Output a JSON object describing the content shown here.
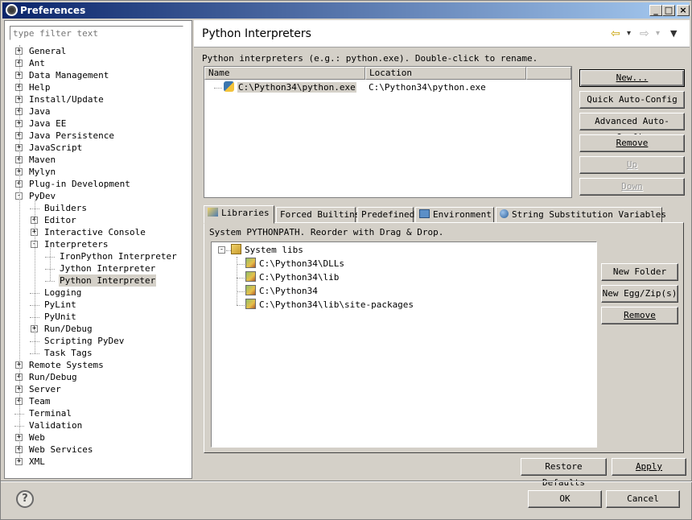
{
  "window": {
    "title": "Preferences",
    "min_glyph": "_",
    "max_glyph": "□",
    "close_glyph": "×"
  },
  "filter": {
    "placeholder": "type filter text"
  },
  "tree": [
    {
      "label": "General",
      "level": 0,
      "exp": "+"
    },
    {
      "label": "Ant",
      "level": 0,
      "exp": "+"
    },
    {
      "label": "Data Management",
      "level": 0,
      "exp": "+"
    },
    {
      "label": "Help",
      "level": 0,
      "exp": "+"
    },
    {
      "label": "Install/Update",
      "level": 0,
      "exp": "+"
    },
    {
      "label": "Java",
      "level": 0,
      "exp": "+"
    },
    {
      "label": "Java EE",
      "level": 0,
      "exp": "+"
    },
    {
      "label": "Java Persistence",
      "level": 0,
      "exp": "+"
    },
    {
      "label": "JavaScript",
      "level": 0,
      "exp": "+"
    },
    {
      "label": "Maven",
      "level": 0,
      "exp": "+"
    },
    {
      "label": "Mylyn",
      "level": 0,
      "exp": "+"
    },
    {
      "label": "Plug-in Development",
      "level": 0,
      "exp": "+"
    },
    {
      "label": "PyDev",
      "level": 0,
      "exp": "-"
    },
    {
      "label": "Builders",
      "level": 1,
      "exp": ""
    },
    {
      "label": "Editor",
      "level": 1,
      "exp": "+"
    },
    {
      "label": "Interactive Console",
      "level": 1,
      "exp": "+"
    },
    {
      "label": "Interpreters",
      "level": 1,
      "exp": "-"
    },
    {
      "label": "IronPython Interpreter",
      "level": 2,
      "exp": ""
    },
    {
      "label": "Jython Interpreter",
      "level": 2,
      "exp": ""
    },
    {
      "label": "Python Interpreter",
      "level": 2,
      "exp": "",
      "selected": true
    },
    {
      "label": "Logging",
      "level": 1,
      "exp": ""
    },
    {
      "label": "PyLint",
      "level": 1,
      "exp": ""
    },
    {
      "label": "PyUnit",
      "level": 1,
      "exp": ""
    },
    {
      "label": "Run/Debug",
      "level": 1,
      "exp": "+"
    },
    {
      "label": "Scripting PyDev",
      "level": 1,
      "exp": ""
    },
    {
      "label": "Task Tags",
      "level": 1,
      "exp": ""
    },
    {
      "label": "Remote Systems",
      "level": 0,
      "exp": "+"
    },
    {
      "label": "Run/Debug",
      "level": 0,
      "exp": "+"
    },
    {
      "label": "Server",
      "level": 0,
      "exp": "+"
    },
    {
      "label": "Team",
      "level": 0,
      "exp": "+"
    },
    {
      "label": "Terminal",
      "level": 0,
      "exp": ""
    },
    {
      "label": "Validation",
      "level": 0,
      "exp": ""
    },
    {
      "label": "Web",
      "level": 0,
      "exp": "+"
    },
    {
      "label": "Web Services",
      "level": 0,
      "exp": "+"
    },
    {
      "label": "XML",
      "level": 0,
      "exp": "+"
    }
  ],
  "page": {
    "title": "Python Interpreters",
    "description": "Python interpreters (e.g.: python.exe).   Double-click to rename.",
    "back_icon": "⇦",
    "forward_icon": "⇨",
    "dropdown_glyph": "▾",
    "menu_glyph": "▼"
  },
  "interpreters": {
    "columns": [
      "Name",
      "Location"
    ],
    "rows": [
      {
        "name": "C:\\Python34\\python.exe",
        "location": "C:\\Python34\\python.exe"
      }
    ]
  },
  "side_buttons": {
    "new": "New...",
    "quick": "Quick Auto-Config",
    "advanced": "Advanced Auto-Config",
    "remove": "Remove",
    "up": "Up",
    "down": "Down"
  },
  "tabs": [
    "Libraries",
    "Forced Builtins",
    "Predefined",
    "Environment",
    "String Substitution Variables"
  ],
  "libraries": {
    "description": "System PYTHONPATH.   Reorder with Drag & Drop.",
    "root": "System libs",
    "items": [
      "C:\\Python34\\DLLs",
      "C:\\Python34\\lib",
      "C:\\Python34",
      "C:\\Python34\\lib\\site-packages"
    ],
    "new_folder": "New Folder",
    "new_egg": "New Egg/Zip(s)",
    "remove": "Remove"
  },
  "footer": {
    "restore_defaults": "Restore Defaults",
    "apply": "Apply",
    "ok": "OK",
    "cancel": "Cancel",
    "help_glyph": "?"
  }
}
